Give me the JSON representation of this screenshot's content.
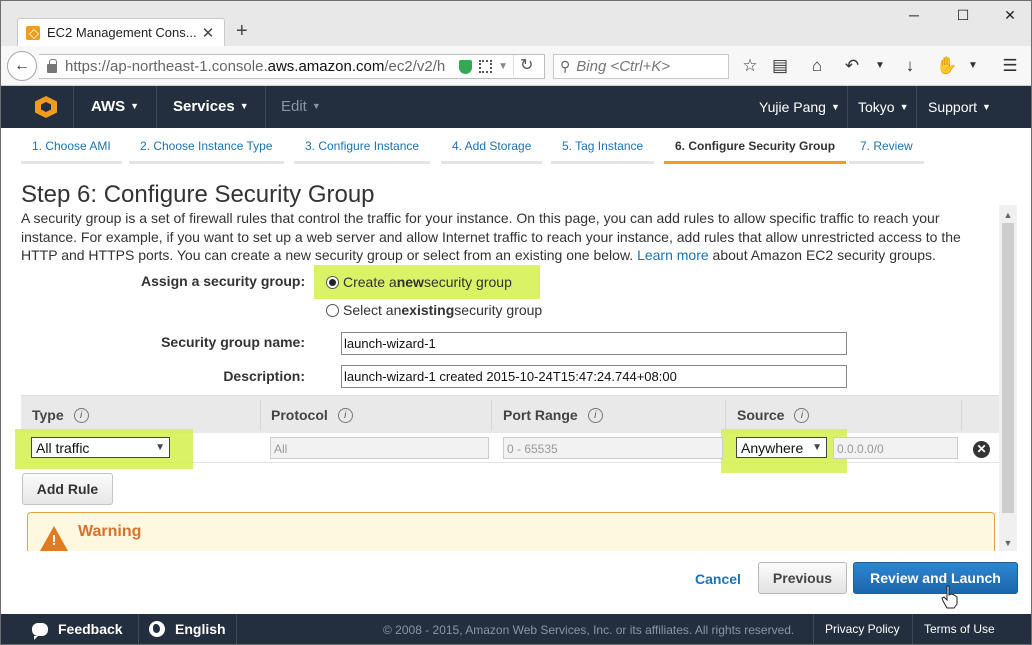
{
  "browser": {
    "tab_title": "EC2 Management Cons...",
    "url_prefix": "https://ap-northeast-1.console.",
    "url_host": "aws.amazon.com",
    "url_path": "/ec2/v2/h",
    "search_placeholder": "Bing <Ctrl+K>",
    "icons": [
      "back-icon",
      "lock-icon",
      "shield-icon",
      "qr-icon",
      "reload-icon",
      "search-icon",
      "star-icon",
      "reader-icon",
      "home-icon",
      "undo-icon",
      "download-icon",
      "addon-icon",
      "menu-icon"
    ]
  },
  "aws_header": {
    "brand": "AWS",
    "services": "Services",
    "edit": "Edit",
    "user": "Yujie Pang",
    "region": "Tokyo",
    "support": "Support"
  },
  "steps": [
    {
      "label": "1. Choose AMI"
    },
    {
      "label": "2. Choose Instance Type"
    },
    {
      "label": "3. Configure Instance"
    },
    {
      "label": "4. Add Storage"
    },
    {
      "label": "5. Tag Instance"
    },
    {
      "label": "6. Configure Security Group",
      "active": true
    },
    {
      "label": "7. Review"
    }
  ],
  "main": {
    "title": "Step 6: Configure Security Group",
    "intro": "A security group is a set of firewall rules that control the traffic for your instance. On this page, you can add rules to allow specific traffic to reach your instance. For example, if you want to set up a web server and allow Internet traffic to reach your instance, add rules that allow unrestricted access to the HTTP and HTTPS ports. You can create a new security group or select from an existing one below.",
    "learn_more": "Learn more",
    "intro_tail": "about Amazon EC2 security groups.",
    "assign_label": "Assign a security group:",
    "option_new_pre": "Create a ",
    "option_new_bold": "new",
    "option_new_post": " security group",
    "option_existing_pre": "Select an ",
    "option_existing_bold": "existing",
    "option_existing_post": " security group",
    "name_label": "Security group name:",
    "name_value": "launch-wizard-1",
    "desc_label": "Description:",
    "desc_value": "launch-wizard-1 created 2015-10-24T15:47:24.744+08:00"
  },
  "rules_table": {
    "headers": [
      "Type",
      "Protocol",
      "Port Range",
      "Source"
    ],
    "info_glyph": "i",
    "row": {
      "type": "All traffic",
      "protocol": "All",
      "port_range": "0 - 65535",
      "source": "Anywhere",
      "cidr": "0.0.0.0/0"
    },
    "add_rule": "Add Rule"
  },
  "warning": {
    "title": "Warning",
    "glyph": "!"
  },
  "actions": {
    "cancel": "Cancel",
    "previous": "Previous",
    "review_launch": "Review and Launch"
  },
  "footer": {
    "feedback": "Feedback",
    "language": "English",
    "copyright": "© 2008 - 2015, Amazon Web Services, Inc. or its affiliates. All rights reserved.",
    "privacy": "Privacy Policy",
    "terms": "Terms of Use"
  },
  "colors": {
    "aws_dark": "#232f3e",
    "aws_orange": "#f29b1f",
    "link_blue": "#1a73b7",
    "highlight": "#d3f04a",
    "primary_button": "#1a66ad"
  }
}
